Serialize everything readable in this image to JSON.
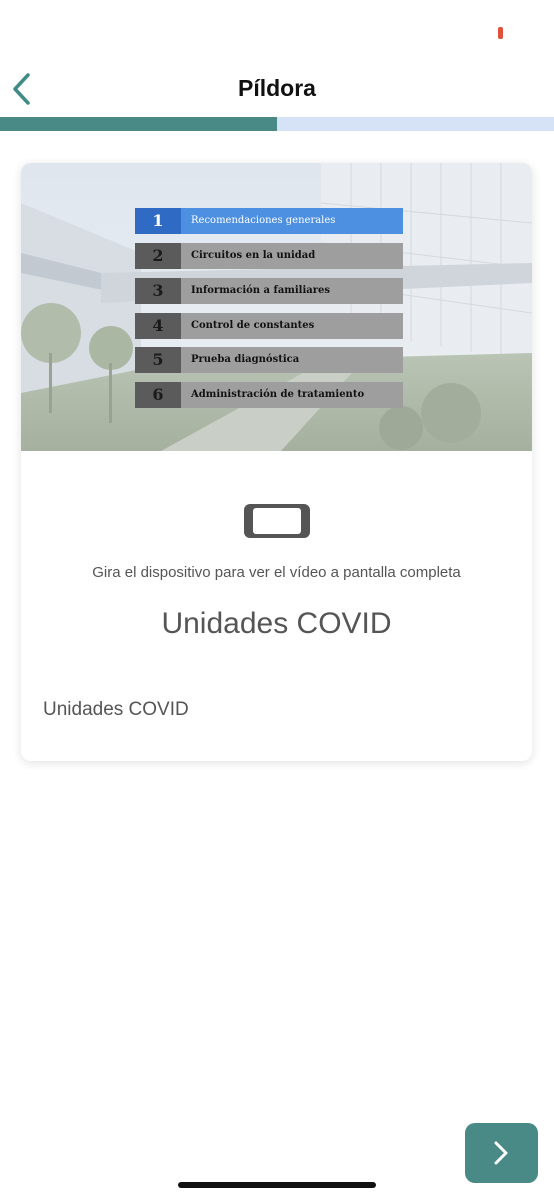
{
  "header": {
    "title": "Píldora",
    "back_icon": "chevron-left-icon"
  },
  "progress": {
    "fraction": 0.5,
    "fill_color": "#4a8a86",
    "track_color": "#d6e2f5"
  },
  "video": {
    "menu": [
      {
        "number": "1",
        "label": "Recomendaciones generales",
        "active": true
      },
      {
        "number": "2",
        "label": "Circuitos en la unidad",
        "active": false
      },
      {
        "number": "3",
        "label": "Información a familiares",
        "active": false
      },
      {
        "number": "4",
        "label": "Control de constantes",
        "active": false
      },
      {
        "number": "5",
        "label": "Prueba diagnóstica",
        "active": false
      },
      {
        "number": "6",
        "label": "Administración de tratamiento",
        "active": false
      }
    ]
  },
  "card": {
    "device_icon": "phone-landscape-icon",
    "rotate_hint": "Gira el dispositivo para ver el vídeo a pantalla completa",
    "title": "Unidades COVID",
    "description": "Unidades COVID"
  },
  "footer": {
    "next_icon": "chevron-right-icon",
    "next_color": "#4a8a86"
  }
}
